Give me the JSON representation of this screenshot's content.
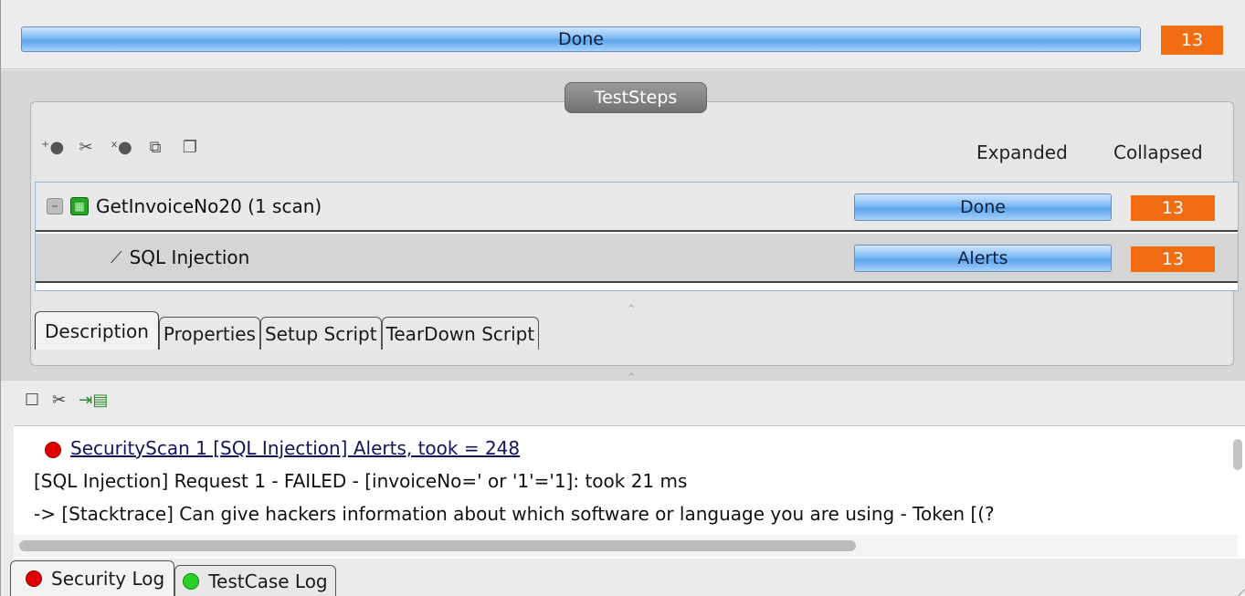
{
  "top": {
    "progress_label": "Done",
    "progress_fraction": 1.0,
    "count": "13"
  },
  "steps": {
    "title": "TestSteps",
    "toolbar_icons": [
      "add-step-icon",
      "tools-icon",
      "remove-step-icon",
      "clone-step-icon",
      "copy-step-icon"
    ],
    "col_expanded": "Expanded",
    "col_collapsed": "Collapsed",
    "rows": [
      {
        "label": "GetInvoiceNo20 (1 scan)",
        "status": "Done",
        "count": "13"
      },
      {
        "label": "SQL Injection",
        "status": "Alerts",
        "count": "13"
      }
    ],
    "tabs": [
      "Description",
      "Properties",
      "Setup Script",
      "TearDown Script"
    ]
  },
  "log": {
    "toolbar_icons": [
      "checkbox-icon",
      "tools-icon",
      "export-log-icon"
    ],
    "lines": [
      "SecurityScan 1 [SQL Injection] Alerts, took = 248",
      "[SQL Injection] Request 1 - FAILED - [invoiceNo=' or '1'='1]: took 21 ms",
      " -> [Stacktrace] Can give hackers information about which software or language you are using - Token [(?"
    ],
    "tabs": [
      "Security Log",
      "TestCase Log"
    ]
  },
  "colors": {
    "accent_orange": "#f26d12",
    "progress_blue": "#5aa4ec",
    "alert_red": "#e00000",
    "ok_green": "#2ad12a"
  }
}
